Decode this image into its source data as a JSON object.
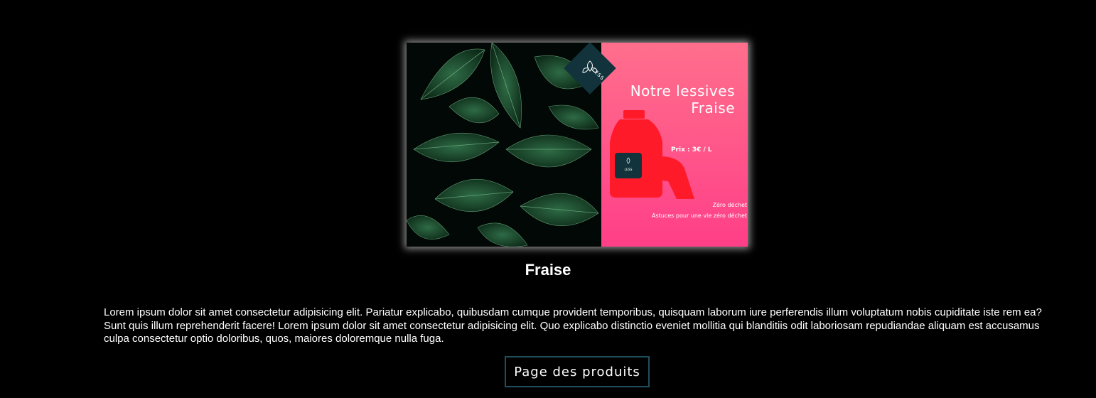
{
  "banner": {
    "headline_line1": "Notre lessives",
    "headline_line2": "Fraise",
    "price": "Prix :  3€ / L",
    "tagline1": "Zéro déchet",
    "tagline2": "Astuces pour une vie zéro déchet",
    "logo_text": "LESS",
    "bottle_logo_text": "LESS",
    "colors": {
      "gradient_top": "#ff6f8c",
      "gradient_bottom": "#ff3f88",
      "bottle": "#ff1a2a",
      "logo_bg": "#12333b"
    }
  },
  "product": {
    "title": "Fraise",
    "description": "Lorem ipsum dolor sit amet consectetur adipisicing elit. Pariatur explicabo, quibusdam cumque provident temporibus, quisquam laborum iure perferendis illum voluptatum nobis cupiditate iste rem ea? Sunt quis illum reprehenderit facere! Lorem ipsum dolor sit amet consectetur adipisicing elit. Quo explicabo distinctio eveniet mollitia qui blanditiis odit laboriosam repudiandae aliquam est accusamus culpa consectetur optio doloribus, quos, maiores doloremque nulla fuga."
  },
  "actions": {
    "products_button_label": "Page des produits"
  }
}
